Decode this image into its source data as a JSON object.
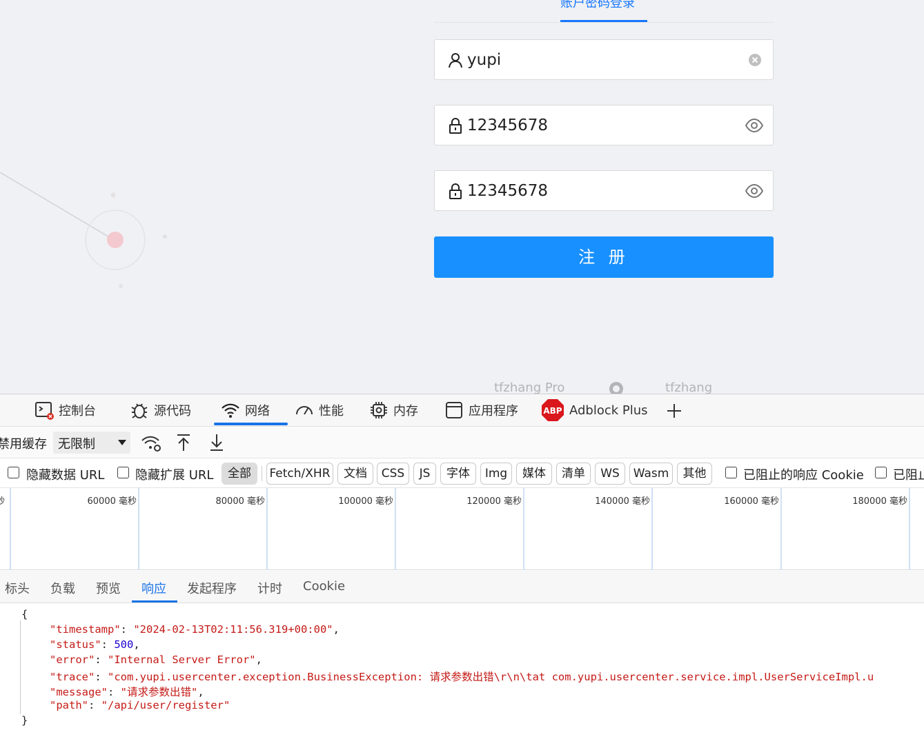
{
  "login": {
    "tab_label": "账户密码登录",
    "username": "yupi",
    "password": "12345678",
    "check_password": "12345678",
    "submit_label": "注 册",
    "footer": [
      "tfzhang Pro",
      "tfzhang"
    ]
  },
  "devtools": {
    "tabs": [
      {
        "label": "控制台"
      },
      {
        "label": "源代码"
      },
      {
        "label": "网络"
      },
      {
        "label": "性能"
      },
      {
        "label": "内存"
      },
      {
        "label": "应用程序"
      },
      {
        "label": "Adblock Plus"
      }
    ],
    "active_tab": "网络",
    "toolbar": {
      "disable_cache": "禁用缓存",
      "throttle": "无限制"
    },
    "filters": {
      "hide_data_url": "隐藏数据 URL",
      "hide_ext_url": "隐藏扩展 URL",
      "types": [
        "全部",
        "Fetch/XHR",
        "文档",
        "CSS",
        "JS",
        "字体",
        "Img",
        "媒体",
        "清单",
        "WS",
        "Wasm",
        "其他"
      ],
      "selected_type": "全部",
      "blocked_cookies": "已阻止的响应 Cookie",
      "blocked_requests": "已阻止"
    },
    "timeline": {
      "leading": "秒",
      "ticks": [
        "60000  毫秒",
        "80000  毫秒",
        "100000  毫秒",
        "120000  毫秒",
        "140000  毫秒",
        "160000  毫秒",
        "180000  毫秒"
      ]
    },
    "subtabs": [
      "标头",
      "负载",
      "预览",
      "响应",
      "发起程序",
      "计时",
      "Cookie"
    ],
    "active_subtab": "响应",
    "response": {
      "open_brace": "{",
      "close_brace": "}",
      "lines": [
        {
          "key": "\"timestamp\"",
          "value": "\"2024-02-13T02:11:56.319+00:00\"",
          "type": "string",
          "comma": ","
        },
        {
          "key": "\"status\"",
          "value": "500",
          "type": "number",
          "comma": ","
        },
        {
          "key": "\"error\"",
          "value": "\"Internal Server Error\"",
          "type": "string",
          "comma": ","
        },
        {
          "key": "\"trace\"",
          "value": "\"com.yupi.usercenter.exception.BusinessException: 请求参数出错\\r\\n\\tat com.yupi.usercenter.service.impl.UserServiceImpl.u",
          "type": "string",
          "comma": ""
        },
        {
          "key": "\"message\"",
          "value": "\"请求参数出错\"",
          "type": "string",
          "comma": ","
        },
        {
          "key": "\"path\"",
          "value": "\"/api/user/register\"",
          "type": "string",
          "comma": ""
        }
      ]
    }
  },
  "colors": {
    "primary": "#1890ff",
    "devtools_accent": "#1a73e8",
    "json_key": "#c41a16",
    "json_number": "#1c00cf"
  }
}
